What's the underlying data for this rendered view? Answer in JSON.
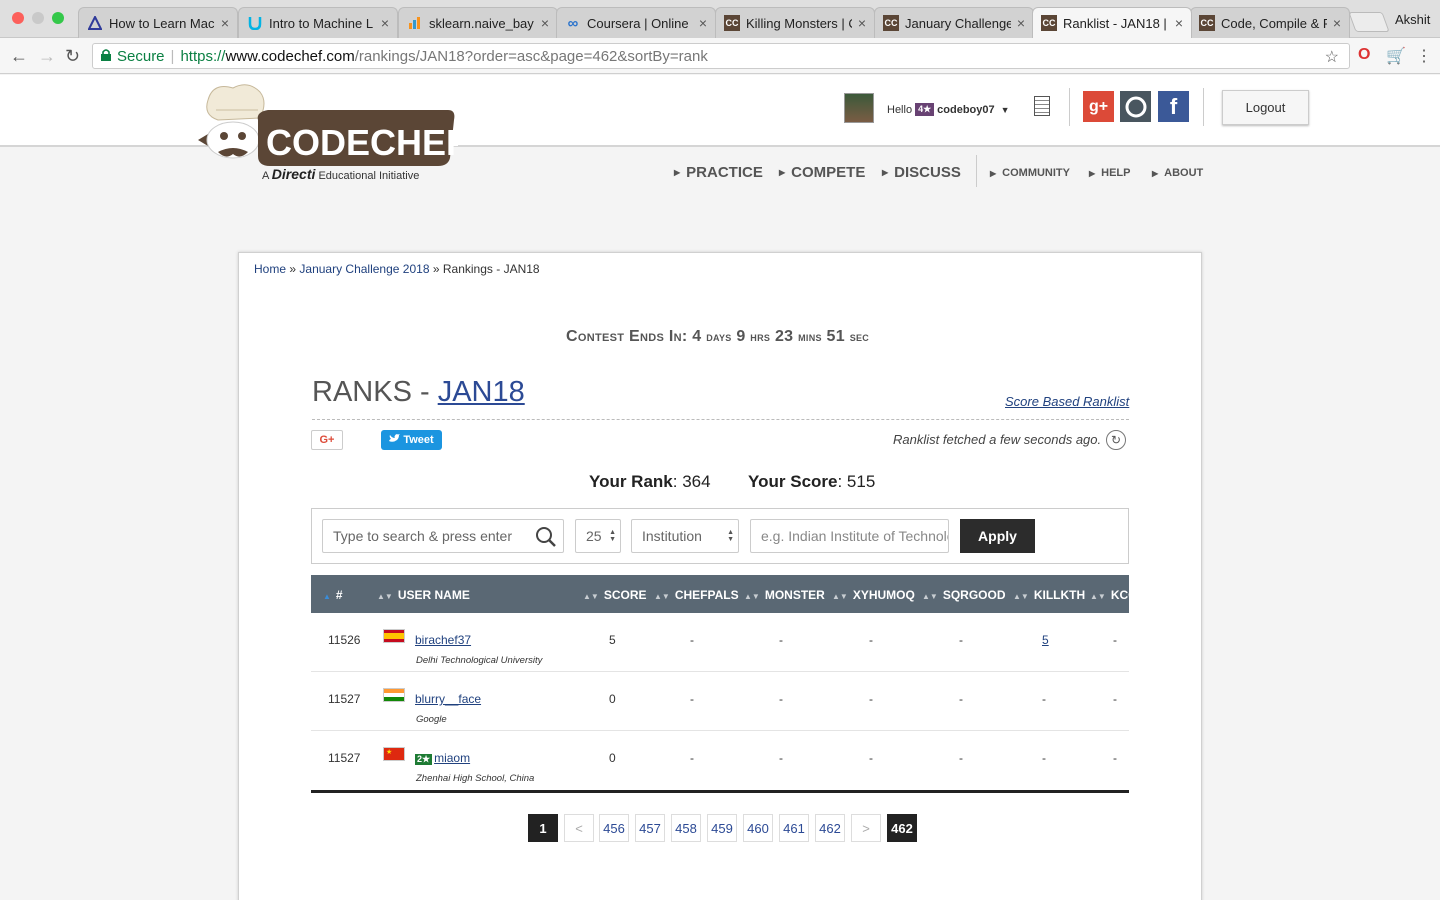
{
  "browser": {
    "tabs": [
      {
        "title": "How to Learn Mac",
        "favicon": "triangle-icon"
      },
      {
        "title": "Intro to Machine L",
        "favicon": "u-icon"
      },
      {
        "title": "sklearn.naive_bay",
        "favicon": "bars-icon"
      },
      {
        "title": "Coursera | Online",
        "favicon": "infinity-icon"
      },
      {
        "title": "Killing Monsters | C",
        "favicon": "cc-icon"
      },
      {
        "title": "January Challenge",
        "favicon": "cc-icon"
      },
      {
        "title": "Ranklist - JAN18 |",
        "favicon": "cc-icon"
      },
      {
        "title": "Code, Compile & R",
        "favicon": "cc-icon"
      }
    ],
    "profile_name": "Akshit",
    "secure_label": "Secure",
    "url_scheme": "https://",
    "url_host": "www.codechef.com",
    "url_path": "/rankings/JAN18?order=asc&page=462&sortBy=rank"
  },
  "header": {
    "logo_text": "CODECHEF",
    "logo_tagline_a": "A",
    "logo_tagline_brand": "Directi",
    "logo_tagline_rest": "Educational Initiative",
    "hello": "Hello",
    "user_stars": "4★",
    "username": "codeboy07",
    "logout": "Logout",
    "nav": [
      "PRACTICE",
      "COMPETE",
      "DISCUSS",
      "COMMUNITY",
      "HELP",
      "ABOUT"
    ]
  },
  "breadcrumb": {
    "home": "Home",
    "sep1": "»",
    "contest": "January Challenge 2018",
    "sep2": "»",
    "current": "Rankings - JAN18"
  },
  "timer": {
    "label": "Contest Ends In:",
    "days": "4",
    "days_unit": "days",
    "hrs": "9",
    "hrs_unit": "hrs",
    "mins": "23",
    "mins_unit": "mins",
    "sec": "51",
    "sec_unit": "sec"
  },
  "ranks": {
    "title_prefix": "RANKS - ",
    "contest_code": "JAN18",
    "score_based_link": "Score Based Ranklist",
    "gplus_label": "G+",
    "tweet_label": "Tweet",
    "fetched_text": "Ranklist fetched a few seconds ago.",
    "your_rank_label": "Your Rank",
    "your_rank_value": ": 364",
    "your_score_label": "Your Score",
    "your_score_value": ": 515"
  },
  "filters": {
    "search_placeholder": "Type to search & press enter",
    "page_size": "25",
    "filter_by": "Institution",
    "institution_placeholder": "e.g. Indian Institute of Technology",
    "apply": "Apply"
  },
  "table": {
    "columns": [
      "#",
      "USER NAME",
      "SCORE",
      "CHEFPALS",
      "MONSTER",
      "XYHUMOQ",
      "SQRGOOD",
      "KILLKTH",
      "KCO"
    ],
    "rows": [
      {
        "rank": "11526",
        "flag": "spain",
        "badge": "",
        "user": "birachef37",
        "institution": "Delhi Technological University",
        "score": "5",
        "chefpals": "-",
        "monster": "-",
        "xyhumoq": "-",
        "sqrgood": "-",
        "killkth": "5",
        "kco": "-"
      },
      {
        "rank": "11527",
        "flag": "india",
        "badge": "",
        "user": "blurry__face",
        "institution": "Google",
        "score": "0",
        "chefpals": "-",
        "monster": "-",
        "xyhumoq": "-",
        "sqrgood": "-",
        "killkth": "-",
        "kco": "-"
      },
      {
        "rank": "11527",
        "flag": "china",
        "badge": "2★",
        "user": "miaom",
        "institution": "Zhenhai High School, China",
        "score": "0",
        "chefpals": "-",
        "monster": "-",
        "xyhumoq": "-",
        "sqrgood": "-",
        "killkth": "-",
        "kco": "-"
      }
    ]
  },
  "pagination": {
    "first": "1",
    "prev": "<",
    "pages": [
      "456",
      "457",
      "458",
      "459",
      "460",
      "461",
      "462"
    ],
    "next": ">",
    "current": "462"
  }
}
